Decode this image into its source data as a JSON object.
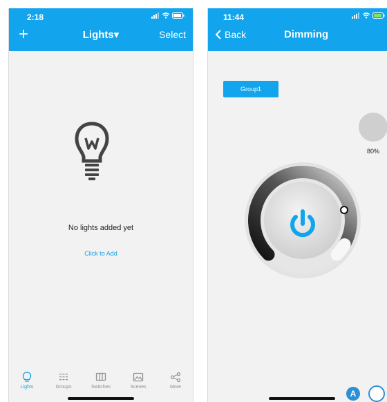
{
  "phone1": {
    "status": {
      "time": "2:18"
    },
    "nav": {
      "add_glyph": "+",
      "title": "Lights▾",
      "select": "Select"
    },
    "empty_message": "No lights added yet",
    "add_link": "Click to Add",
    "tabs": [
      {
        "label": "Lights",
        "icon": "bulb-icon",
        "active": true
      },
      {
        "label": "Groups",
        "icon": "grid-icon",
        "active": false
      },
      {
        "label": "Switches",
        "icon": "switch-panel-icon",
        "active": false
      },
      {
        "label": "Scenes",
        "icon": "image-icon",
        "active": false
      },
      {
        "label": "More",
        "icon": "share-icon",
        "active": false
      }
    ]
  },
  "phone2": {
    "status": {
      "time": "11:44"
    },
    "nav": {
      "back": "Back",
      "title": "Dimming"
    },
    "group_button": "Group1",
    "brightness": {
      "label": "80%",
      "value_percent": 80
    }
  },
  "colors": {
    "accent": "#12a4ec",
    "background": "#f2f2f2",
    "tab_inactive": "#8f8f8f"
  }
}
